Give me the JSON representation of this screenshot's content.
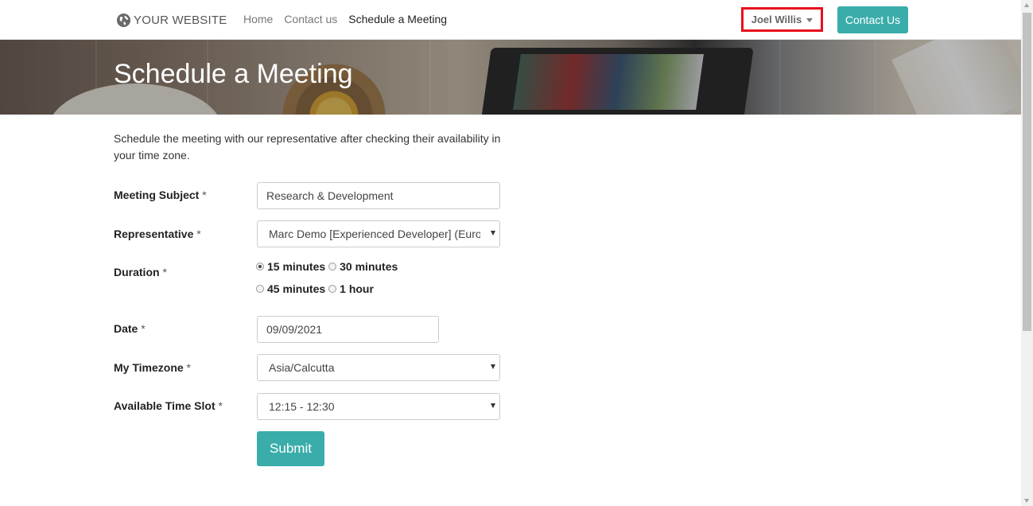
{
  "navbar": {
    "brand": "YOUR WEBSITE",
    "links": [
      "Home",
      "Contact us",
      "Schedule a Meeting"
    ],
    "active_link": "Schedule a Meeting",
    "user_name": "Joel Willis",
    "contact_button": "Contact Us"
  },
  "hero": {
    "title": "Schedule a Meeting"
  },
  "form": {
    "intro": "Schedule the meeting with our representative after checking their availability in your time zone.",
    "required_mark": "*",
    "meeting_subject": {
      "label": "Meeting Subject",
      "value": "Research & Development"
    },
    "representative": {
      "label": "Representative",
      "value": "Marc Demo [Experienced Developer] (Europe/Brussels)"
    },
    "duration": {
      "label": "Duration",
      "options": [
        "15 minutes",
        "30 minutes",
        "45 minutes",
        "1 hour"
      ],
      "selected": "15 minutes"
    },
    "date": {
      "label": "Date",
      "value": "09/09/2021"
    },
    "timezone": {
      "label": "My Timezone",
      "value": "Asia/Calcutta"
    },
    "time_slot": {
      "label": "Available Time Slot",
      "value": "12:15 - 12:30"
    },
    "submit": "Submit"
  },
  "colors": {
    "accent": "#3aadaa",
    "highlight_box": "#e8101c"
  }
}
